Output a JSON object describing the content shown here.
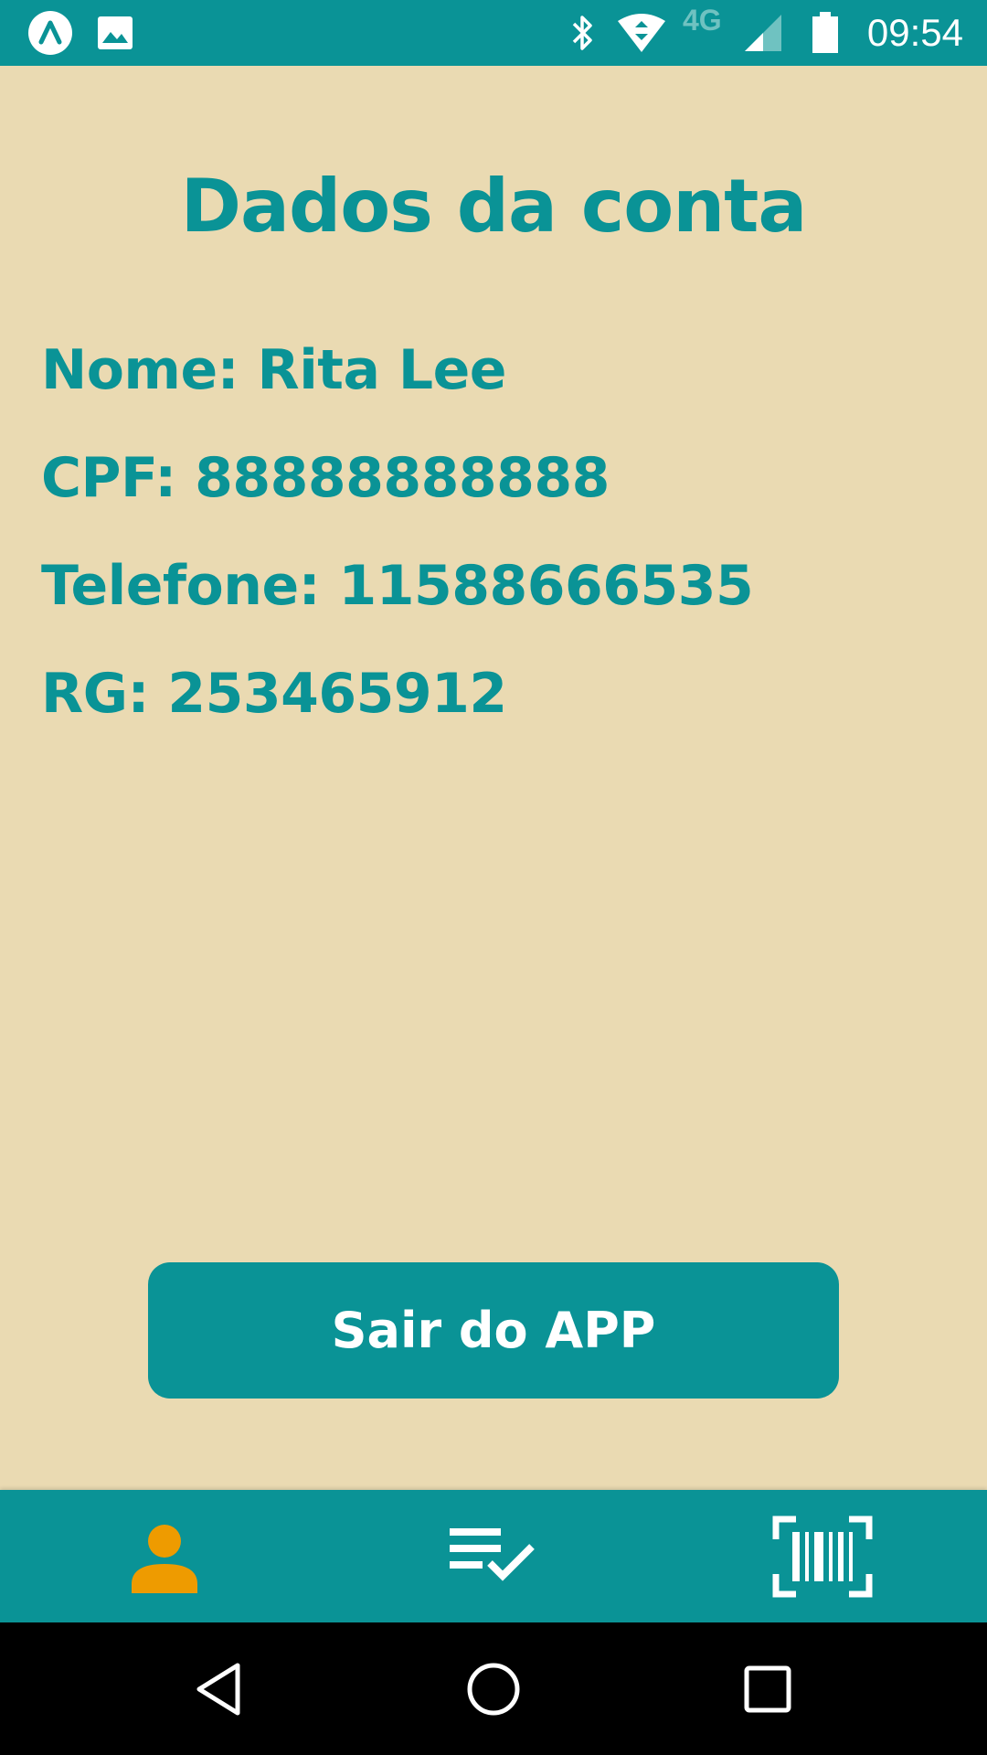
{
  "status_bar": {
    "time": "09:54",
    "network_label": "4G",
    "icons": [
      "app-notification-icon",
      "image-notification-icon",
      "bluetooth-icon",
      "wifi-icon",
      "cell-signal-icon",
      "battery-icon"
    ]
  },
  "account": {
    "title": "Dados da conta",
    "name_line": "Nome: Rita Lee",
    "cpf_line": "CPF: 88888888888",
    "phone_line": "Telefone: 11588666535",
    "rg_line": "RG: 253465912"
  },
  "logout_button": {
    "label": "Sair do APP"
  },
  "bottom_nav": {
    "tabs": [
      {
        "icon": "person-icon",
        "active": true
      },
      {
        "icon": "checklist-icon",
        "active": false
      },
      {
        "icon": "barcode-scan-icon",
        "active": false
      }
    ]
  },
  "system_nav": {
    "buttons": [
      "back-icon",
      "home-icon",
      "recents-icon"
    ]
  },
  "colors": {
    "primary": "#0A9396",
    "background": "#EADAB2",
    "active_tab": "#EE9B00",
    "button_text": "#FFFFFF"
  }
}
